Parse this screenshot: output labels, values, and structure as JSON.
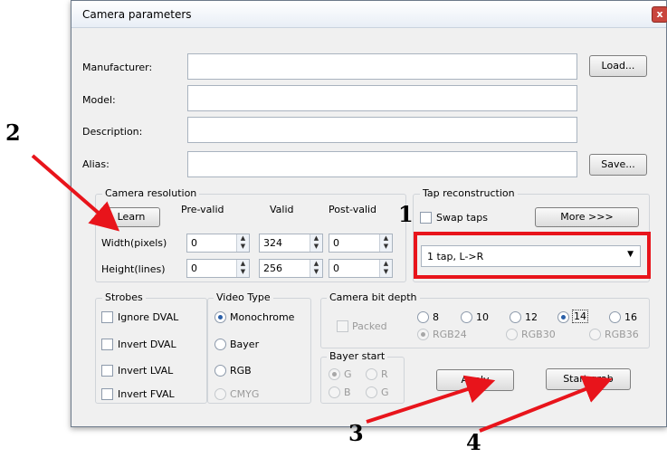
{
  "window": {
    "title": "Camera parameters",
    "close_glyph": "x"
  },
  "fields": {
    "manufacturer_label": "Manufacturer:",
    "model_label": "Model:",
    "description_label": "Description:",
    "alias_label": "Alias:",
    "load_button": "Load...",
    "save_button": "Save..."
  },
  "resolution": {
    "group_title": "Camera resolution",
    "learn_button": "Learn",
    "col_prevalid": "Pre-valid",
    "col_valid": "Valid",
    "col_postvalid": "Post-valid",
    "width_label": "Width(pixels)",
    "height_label": "Height(lines)",
    "width_prevalid": "0",
    "width_valid": "324",
    "width_postvalid": "0",
    "height_prevalid": "0",
    "height_valid": "256",
    "height_postvalid": "0"
  },
  "tap": {
    "group_title": "Tap reconstruction",
    "swap_label": "Swap taps",
    "more_button": "More >>>",
    "selected": "1 tap, L->R"
  },
  "strobes": {
    "group_title": "Strobes",
    "ignore_dval": "Ignore DVAL",
    "invert_dval": "Invert DVAL",
    "invert_lval": "Invert LVAL",
    "invert_fval": "Invert FVAL"
  },
  "video": {
    "group_title": "Video Type",
    "monochrome": "Monochrome",
    "bayer": "Bayer",
    "rgb": "RGB",
    "cmyg": "CMYG",
    "selected": "Monochrome"
  },
  "bitdepth": {
    "group_title": "Camera bit depth",
    "packed": "Packed",
    "b8": "8",
    "b10": "10",
    "b12": "12",
    "b14": "14",
    "b16": "16",
    "rgb24": "RGB24",
    "rgb30": "RGB30",
    "rgb36": "RGB36",
    "selected": "14"
  },
  "bayer": {
    "group_title": "Bayer start",
    "g1": "G",
    "r": "R",
    "b": "B",
    "g2": "G"
  },
  "actions": {
    "apply": "Apply",
    "start_grab": "Start grab"
  },
  "annotations": {
    "n1": "1",
    "n2": "2",
    "n3": "3",
    "n4": "4",
    "color": "#e8141b"
  }
}
